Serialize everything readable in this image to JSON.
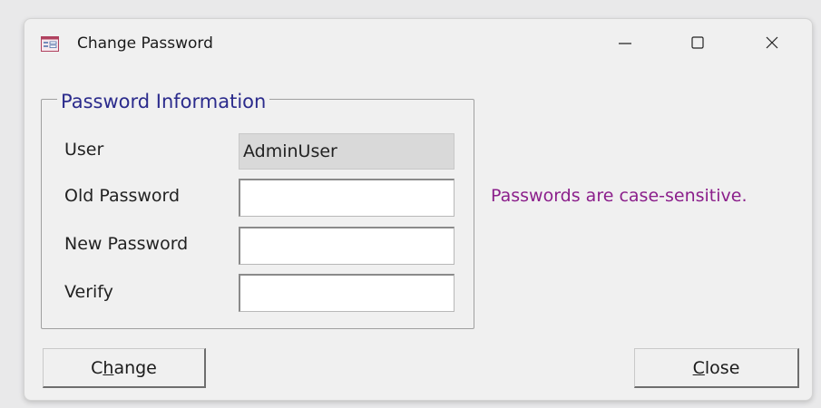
{
  "window": {
    "title": "Change Password",
    "icon": "form-icon",
    "controls": {
      "minimize": "minimize-icon",
      "maximize": "maximize-icon",
      "close": "close-icon"
    }
  },
  "group": {
    "legend": "Password Information",
    "fields": {
      "user": {
        "label": "User",
        "value": "AdminUser"
      },
      "old_password": {
        "label": "Old Password",
        "value": ""
      },
      "new_password": {
        "label": "New Password",
        "value": ""
      },
      "verify": {
        "label": "Verify",
        "value": ""
      }
    }
  },
  "hint": {
    "text": "Passwords are case-sensitive.",
    "color": "#8b1f8b"
  },
  "buttons": {
    "change": {
      "pre": "C",
      "accel": "h",
      "post": "ange"
    },
    "close": {
      "pre": "",
      "accel": "C",
      "post": "lose"
    }
  }
}
